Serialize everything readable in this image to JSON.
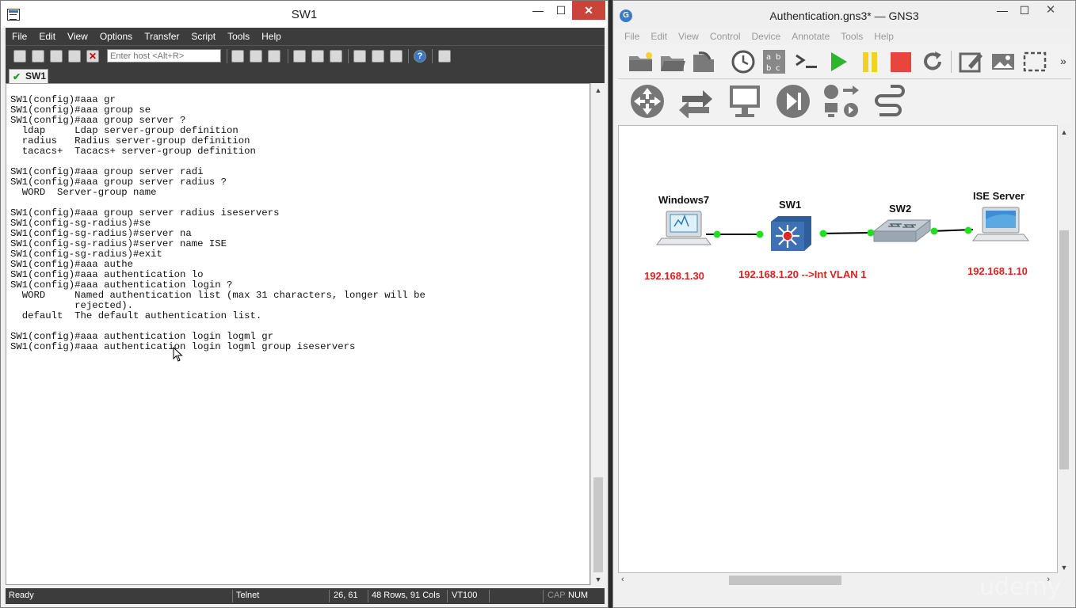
{
  "crt": {
    "title": "SW1",
    "menu": [
      "File",
      "Edit",
      "View",
      "Options",
      "Transfer",
      "Script",
      "Tools",
      "Help"
    ],
    "host_placeholder": "Enter host <Alt+R>",
    "tab_label": "SW1",
    "terminal_lines": [
      "SW1(config)#aaa gr",
      "SW1(config)#aaa group se",
      "SW1(config)#aaa group server ?",
      "  ldap     Ldap server-group definition",
      "  radius   Radius server-group definition",
      "  tacacs+  Tacacs+ server-group definition",
      "",
      "SW1(config)#aaa group server radi",
      "SW1(config)#aaa group server radius ?",
      "  WORD  Server-group name",
      "",
      "SW1(config)#aaa group server radius iseservers",
      "SW1(config-sg-radius)#se",
      "SW1(config-sg-radius)#server na",
      "SW1(config-sg-radius)#server name ISE",
      "SW1(config-sg-radius)#exit",
      "SW1(config)#aaa authe",
      "SW1(config)#aaa authentication lo",
      "SW1(config)#aaa authentication login ?",
      "  WORD     Named authentication list (max 31 characters, longer will be",
      "           rejected).",
      "  default  The default authentication list.",
      "",
      "SW1(config)#aaa authentication login logml gr",
      "SW1(config)#aaa authentication login logml group iseservers"
    ],
    "status": {
      "ready": "Ready",
      "protocol": "Telnet",
      "cursor_pos": "26, 61",
      "size": "48 Rows, 91 Cols",
      "emulation": "VT100",
      "caps": "CAP",
      "num": "NUM"
    }
  },
  "gns": {
    "title": "Authentication.gns3* — GNS3",
    "menu": [
      "File",
      "Edit",
      "View",
      "Control",
      "Device",
      "Annotate",
      "Tools",
      "Help"
    ],
    "nodes": {
      "windows7": "Windows7",
      "sw1": "SW1",
      "sw2": "SW2",
      "ise": "ISE Server"
    },
    "ips": {
      "windows7": "192.168.1.30",
      "sw1": "192.168.1.20 -->Int VLAN 1",
      "ise": "192.168.1.10"
    },
    "colors": {
      "link_status": "#22dd22",
      "ip_text": "#e02020",
      "play": "#2db52d",
      "pause": "#f3d21f",
      "stop": "#e8463c"
    }
  },
  "watermark": "udemy"
}
